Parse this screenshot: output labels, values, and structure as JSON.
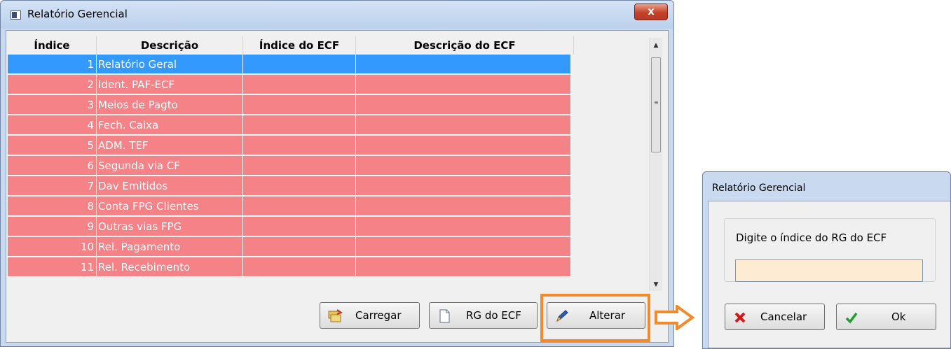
{
  "window": {
    "title": "Relatório Gerencial",
    "close_label": "x"
  },
  "table": {
    "columns": [
      "Índice",
      "Descrição",
      "Índice do ECF",
      "Descrição do ECF"
    ],
    "rows": [
      {
        "indice": "1",
        "descricao": "Relatório Geral",
        "indice_ecf": "",
        "descricao_ecf": "",
        "selected": true
      },
      {
        "indice": "2",
        "descricao": "Ident. PAF-ECF",
        "indice_ecf": "",
        "descricao_ecf": ""
      },
      {
        "indice": "3",
        "descricao": "Meios de Pagto",
        "indice_ecf": "",
        "descricao_ecf": ""
      },
      {
        "indice": "4",
        "descricao": "Fech. Caixa",
        "indice_ecf": "",
        "descricao_ecf": ""
      },
      {
        "indice": "5",
        "descricao": "ADM. TEF",
        "indice_ecf": "",
        "descricao_ecf": ""
      },
      {
        "indice": "6",
        "descricao": "Segunda via CF",
        "indice_ecf": "",
        "descricao_ecf": ""
      },
      {
        "indice": "7",
        "descricao": "Dav Emitidos",
        "indice_ecf": "",
        "descricao_ecf": ""
      },
      {
        "indice": "8",
        "descricao": "Conta FPG Clientes",
        "indice_ecf": "",
        "descricao_ecf": ""
      },
      {
        "indice": "9",
        "descricao": "Outras vias FPG",
        "indice_ecf": "",
        "descricao_ecf": ""
      },
      {
        "indice": "10",
        "descricao": "Rel. Pagamento",
        "indice_ecf": "",
        "descricao_ecf": ""
      },
      {
        "indice": "11",
        "descricao": "Rel. Recebimento",
        "indice_ecf": "",
        "descricao_ecf": ""
      }
    ]
  },
  "buttons": {
    "carregar": "Carregar",
    "rg_ecf": "RG do ECF",
    "alterar": "Alterar"
  },
  "dialog": {
    "title": "Relatório Gerencial",
    "prompt": "Digite o índice do RG do ECF",
    "input_value": "",
    "cancel": "Cancelar",
    "ok": "Ok"
  },
  "colors": {
    "selected_row": "#3399ff",
    "row": "#f58286",
    "highlight": "#f28b2c",
    "input_bg": "#fdebd4"
  }
}
